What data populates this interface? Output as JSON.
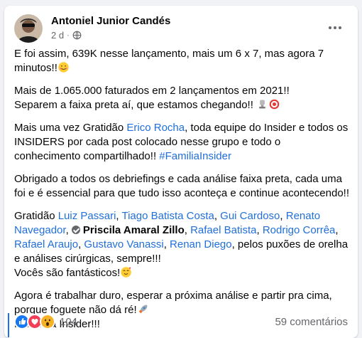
{
  "post": {
    "author": "Antoniel Junior Candés",
    "time": "2 d",
    "more_icon": "more-horizontal-icon",
    "privacy_icon": "public-globe-icon",
    "paragraphs": {
      "p1": "E foi assim, 639K nesse lançamento, mais um 6 x 7, mas agora 7 minutos!!",
      "p2a": "Mais de 1.065.000 faturados em 2 lançamentos em 2021!!",
      "p2b": "Separem a faixa preta aí, que estamos chegando!!",
      "p3a": "Mais uma vez Gratidão ",
      "p3link": "Erico Rocha",
      "p3b": ", toda equipe do Insider e todos os INSIDERS por cada post colocado nesse grupo e todo o conhecimento compartilhado!! ",
      "p3tag": "#FamiliaInsider",
      "p4": "Obrigado a todos os debriefings e cada análise faixa preta, cada uma foi e é essencial para que tudo isso aconteça e continue acontecendo!!",
      "p5a": "Gratidão ",
      "p5_names": {
        "n1": "Luiz Passari",
        "n2": "Tiago Batista Costa",
        "n3": "Gui Cardoso",
        "n4": "Renato Navegador",
        "n5": "Priscila Amaral Zillo",
        "n6": "Rafael Batista",
        "n7": "Rodrigo Corrêa",
        "n8": "Rafael Araujo",
        "n9": "Gustavo Vanassi",
        "n10": "Renan Diego"
      },
      "p5b": ", pelos puxões de orelha e análises cirúrgicas, sempre!!!",
      "p5c": "Vocês são fantásticos!",
      "p6a": "Agora é trabalhar duro, esperar a próxima análise e partir pra cima, porque foguete não dá ré!",
      "p6b": "Pra cima Insider!!!"
    },
    "reactions": {
      "count": "104",
      "icons": [
        "like-icon",
        "love-icon",
        "wow-icon"
      ]
    },
    "comments": "59 comentários",
    "colors": {
      "link": "#216fdb",
      "like": "#1877f2",
      "love": "#f33e58",
      "wow": "#f7b125"
    }
  }
}
